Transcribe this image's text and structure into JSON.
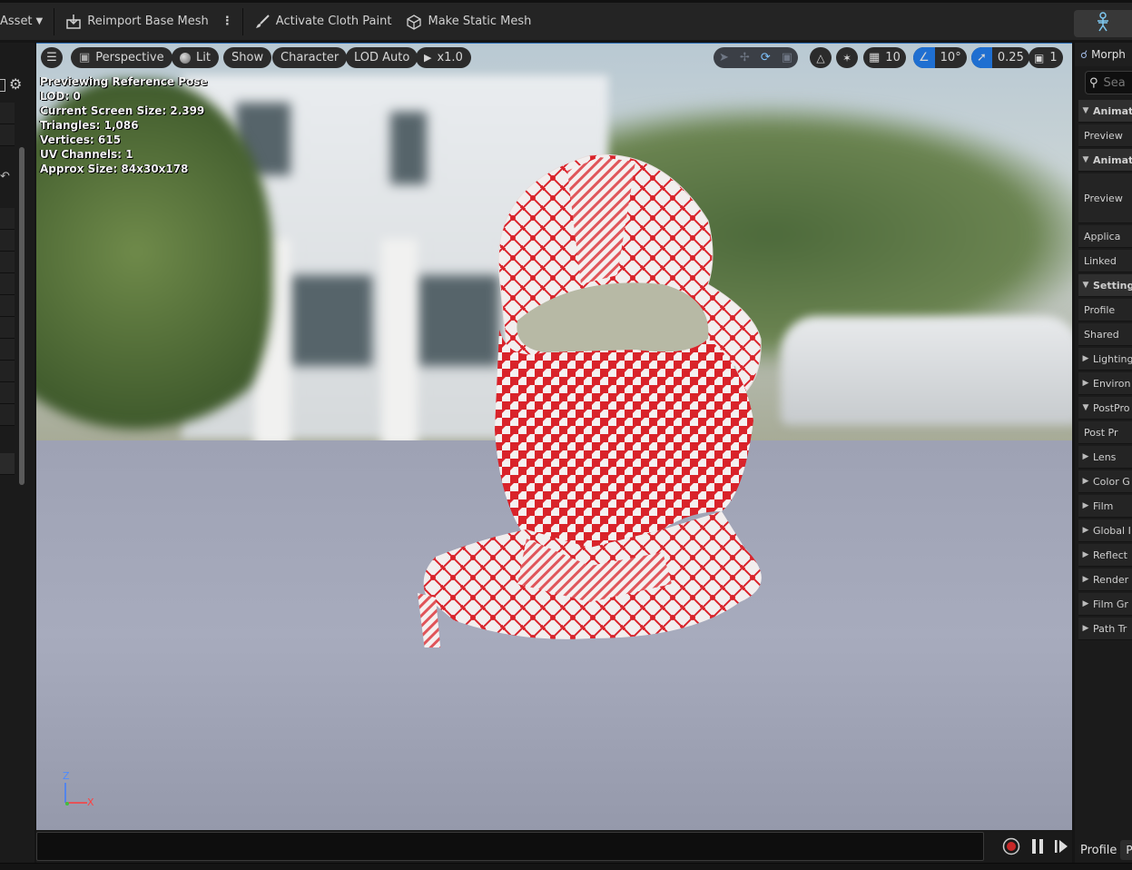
{
  "toolbar": {
    "asset_menu": "Asset",
    "reimport": "Reimport Base Mesh",
    "cloth_paint": "Activate Cloth Paint",
    "static_mesh": "Make Static Mesh"
  },
  "viewport": {
    "view_mode": "Perspective",
    "lighting": "Lit",
    "show": "Show",
    "character": "Character",
    "lod": "LOD Auto",
    "speed": "x1.0",
    "grid_snap": "10",
    "rotation_snap": "10°",
    "scale_snap": "0.25",
    "camera_speed": "1",
    "stats": [
      "Previewing Reference Pose",
      "LOD: 0",
      "Current Screen Size: 2.399",
      "Triangles: 1,086",
      "Vertices: 615",
      "UV Channels: 1",
      "Approx Size: 84x30x178"
    ],
    "axis_z": "Z",
    "axis_x": "X"
  },
  "right_panel": {
    "tab": "Morph",
    "search_placeholder": "Sea",
    "rows": [
      {
        "label": "Animat",
        "type": "header"
      },
      {
        "label": "Preview",
        "type": "item"
      },
      {
        "label": "Animat",
        "type": "header"
      },
      {
        "label": "Preview",
        "type": "item-tall"
      },
      {
        "label": "Applica",
        "type": "item"
      },
      {
        "label": "Linked",
        "type": "item"
      },
      {
        "label": "Setting",
        "type": "header"
      },
      {
        "label": "Profile",
        "type": "item"
      },
      {
        "label": "Shared",
        "type": "item"
      },
      {
        "label": "Lighting",
        "type": "collapsed"
      },
      {
        "label": "Environ",
        "type": "collapsed"
      },
      {
        "label": "PostPro",
        "type": "expanded"
      },
      {
        "label": "Post Pr",
        "type": "item"
      },
      {
        "label": "Lens",
        "type": "collapsed"
      },
      {
        "label": "Color G",
        "type": "collapsed"
      },
      {
        "label": "Film",
        "type": "collapsed"
      },
      {
        "label": "Global I",
        "type": "collapsed"
      },
      {
        "label": "Reflect",
        "type": "collapsed"
      },
      {
        "label": "Render",
        "type": "collapsed"
      },
      {
        "label": "Film Gr",
        "type": "collapsed"
      },
      {
        "label": "Path Tr",
        "type": "collapsed"
      }
    ],
    "profile_label": "Profile",
    "profile_value": "Pr"
  },
  "colors": {
    "accent_blue": "#1f6fd1",
    "record_red": "#c62828",
    "mask_red": "#d9232a"
  }
}
